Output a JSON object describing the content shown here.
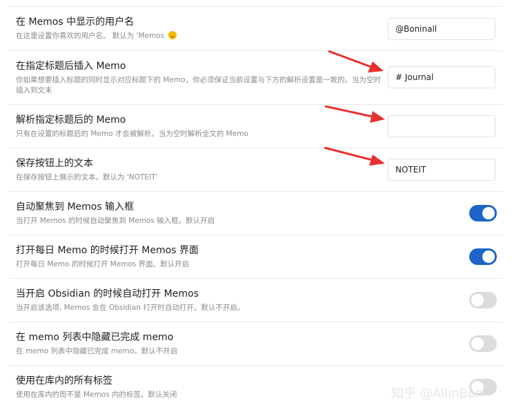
{
  "settings": [
    {
      "title": "在 Memos 中显示的用户名",
      "desc": "在这里设置你喜欢的用户名。 默认为 'Memos ",
      "control": "input",
      "value": "@Boninall",
      "icon": "smirk-emoji-icon"
    },
    {
      "title": "在指定标题后插入 Memo",
      "desc": "你如果想要插入标题的同时显示对应标题下的 Memo，你必须保证当前设置与下方的解析设置是一致的。当为空时插入到文末",
      "control": "input",
      "value": "# Journal"
    },
    {
      "title": "解析指定标题后的 Memo",
      "desc": "只有在设置的标题后的 Memo 才会被解析。当为空时解析全文的 Memo",
      "control": "input",
      "value": ""
    },
    {
      "title": "保存按钮上的文本",
      "desc": "在保存按钮上展示的文本。默认为 'NOTEIT'",
      "control": "input",
      "value": "NOTEIT"
    },
    {
      "title": "自动聚焦到 Memos 输入框",
      "desc": "当打开 Memos 的时候自动聚焦到 Memos 输入框。默认开启",
      "control": "toggle",
      "on": true
    },
    {
      "title": "打开每日 Memo 的时候打开 Memos 界面",
      "desc": "打开每日 Memo 的时候打开 Memos 界面。默认开启",
      "control": "toggle",
      "on": true
    },
    {
      "title": "当开启 Obsidian 的时候自动打开 Memos",
      "desc": "当开启该选项, Memos 会在 Obsidian 打开时自动打开。默认不开启。",
      "control": "toggle",
      "on": false
    },
    {
      "title": "在 memo 列表中隐藏已完成 memo",
      "desc": "在 memo 列表中隐藏已完成 memo。默认不开启",
      "control": "toggle",
      "on": false
    },
    {
      "title": "使用在库内的所有标签",
      "desc": "使用在库内的而不是 Memos 内的标签。默认关闭",
      "control": "toggle",
      "on": false
    }
  ],
  "colors": {
    "accent": "#1b65c9",
    "arrow": "#e8312f",
    "toggle_off": "#dcdcdc"
  },
  "annotations": [
    "red-arrow-icon",
    "red-arrow-icon",
    "red-arrow-icon"
  ],
  "watermark": "知乎 @AllinBon"
}
